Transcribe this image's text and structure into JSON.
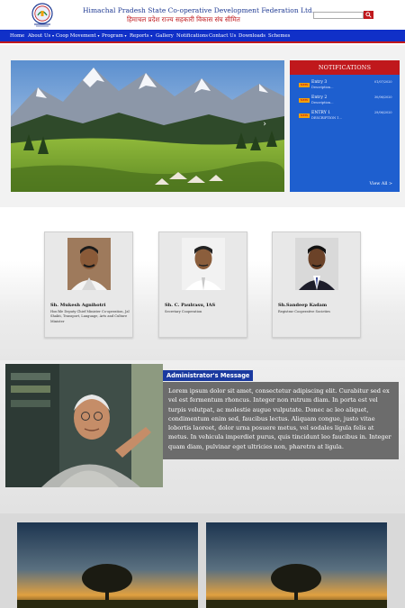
{
  "header": {
    "title_en": "Himachal Pradesh State Co-operative Development Federation Ltd.",
    "title_hi": "हिमाचल प्रदेश राज्य सहकारी विकास संघ सीमित",
    "search_placeholder": "",
    "search_icon": "search-icon"
  },
  "nav": {
    "items": [
      {
        "label": "Home"
      },
      {
        "label": "About Us"
      },
      {
        "label": "Coop Movement"
      },
      {
        "label": "Program"
      },
      {
        "label": "Reports"
      },
      {
        "label": "Gallery"
      },
      {
        "label": "Notifications"
      },
      {
        "label": "Contact Us"
      },
      {
        "label": "Downloads"
      },
      {
        "label": "Schemes"
      }
    ],
    "caret": "▾"
  },
  "slider": {
    "next_arrow": "›"
  },
  "notifications": {
    "heading": "NOTIFICATIONS",
    "badge": "NEW",
    "items": [
      {
        "title": "Entry 3",
        "desc": "Description...",
        "date": "01/07/2020"
      },
      {
        "title": "Entry 2",
        "desc": "Description...",
        "date": "30/06/2020"
      },
      {
        "title": "ENTRY 1",
        "desc": "DESCRIPTION 1...",
        "date": "29/06/2020"
      }
    ],
    "view_all": "View All >"
  },
  "officials": [
    {
      "name": "Sh. Mukesh Agnihotri",
      "designation": "Hon'ble Deputy Chief Minister Co-operation, Jal Shakti, Transport, Language, Arts and Culture Minister"
    },
    {
      "name": "Sh. C. Paulrasu, IAS",
      "designation": "Secretary Cooperation"
    },
    {
      "name": "Sh.Sandeep Kadam",
      "designation": "Registrar Cooperative Societies"
    }
  ],
  "admin": {
    "heading": "Administrator's Message",
    "message": "Lorem ipsum dolor sit amet, consectetur adipiscing elit. Curabitur sed ex vel est fermentum rhoncus. Integer non rutrum diam. In porta est vel turpis volutpat, ac molestie augue vulputate. Donec ac leo aliquet, condimentum enim sed, faucibus lectus. Aliquam congue, justo vitae lobortis laoreet, dolor urna posuere metus, vel sodales ligula felis at metus. In vehicula imperdiet purus, quis tincidunt leo faucibus in. Integer quam diam, pulvinar eget ultricies non, pharetra at ligula."
  },
  "colors": {
    "nav_blue": "#1030c8",
    "brand_red": "#c0181c",
    "notif_blue": "#1e5fcf",
    "title_blue": "#1f3a93"
  }
}
